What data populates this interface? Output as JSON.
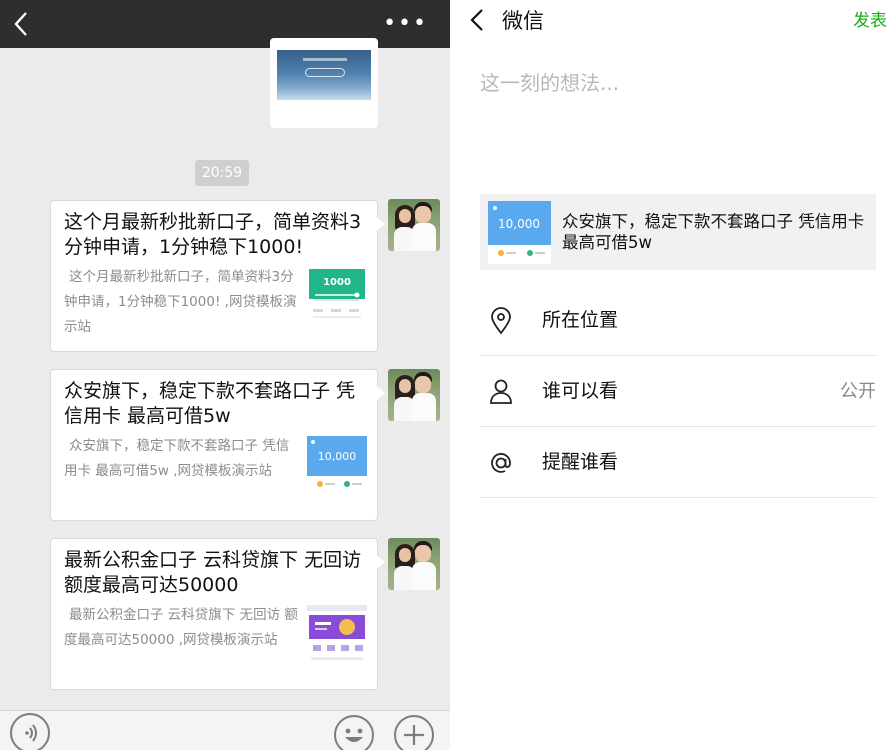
{
  "chat": {
    "more_icon": "more-dots-icon",
    "back_icon": "chevron-left-icon",
    "time_label": "20:59",
    "messages": [
      {
        "title": "这个月最新秒批新口子，简单资料3分钟申请，1分钟稳下1000!",
        "desc": "这个月最新秒批新口子，简单资料3分钟申请，1分钟稳下1000! ,网贷模板演示站",
        "thumb_amount": "1000"
      },
      {
        "title": "众安旗下，稳定下款不套路口子 凭信用卡 最高可借5w",
        "desc": "众安旗下，稳定下款不套路口子 凭信用卡 最高可借5w ,网贷模板演示站",
        "thumb_amount": "10,000"
      },
      {
        "title": "最新公积金口子 云科贷旗下 无回访  额度最高可达50000",
        "desc": "最新公积金口子 云科贷旗下 无回访  额度最高可达50000 ,网贷模板演示站"
      }
    ],
    "bottom_icons": [
      "voice-icon",
      "emoji-icon",
      "plus-icon"
    ]
  },
  "compose": {
    "back_icon": "chevron-left-icon",
    "title": "微信",
    "publish_label": "发表",
    "publish_color": "#1aad19",
    "input_placeholder": "这一刻的想法...",
    "share": {
      "title": "众安旗下，稳定下款不套路口子 凭信用卡 最高可借5w",
      "thumb_amount": "10,000"
    },
    "options": [
      {
        "label": "所在位置",
        "icon": "location-pin-icon",
        "value": ""
      },
      {
        "label": "谁可以看",
        "icon": "user-icon",
        "value": "公开"
      },
      {
        "label": "提醒谁看",
        "icon": "at-icon",
        "value": ""
      }
    ]
  }
}
